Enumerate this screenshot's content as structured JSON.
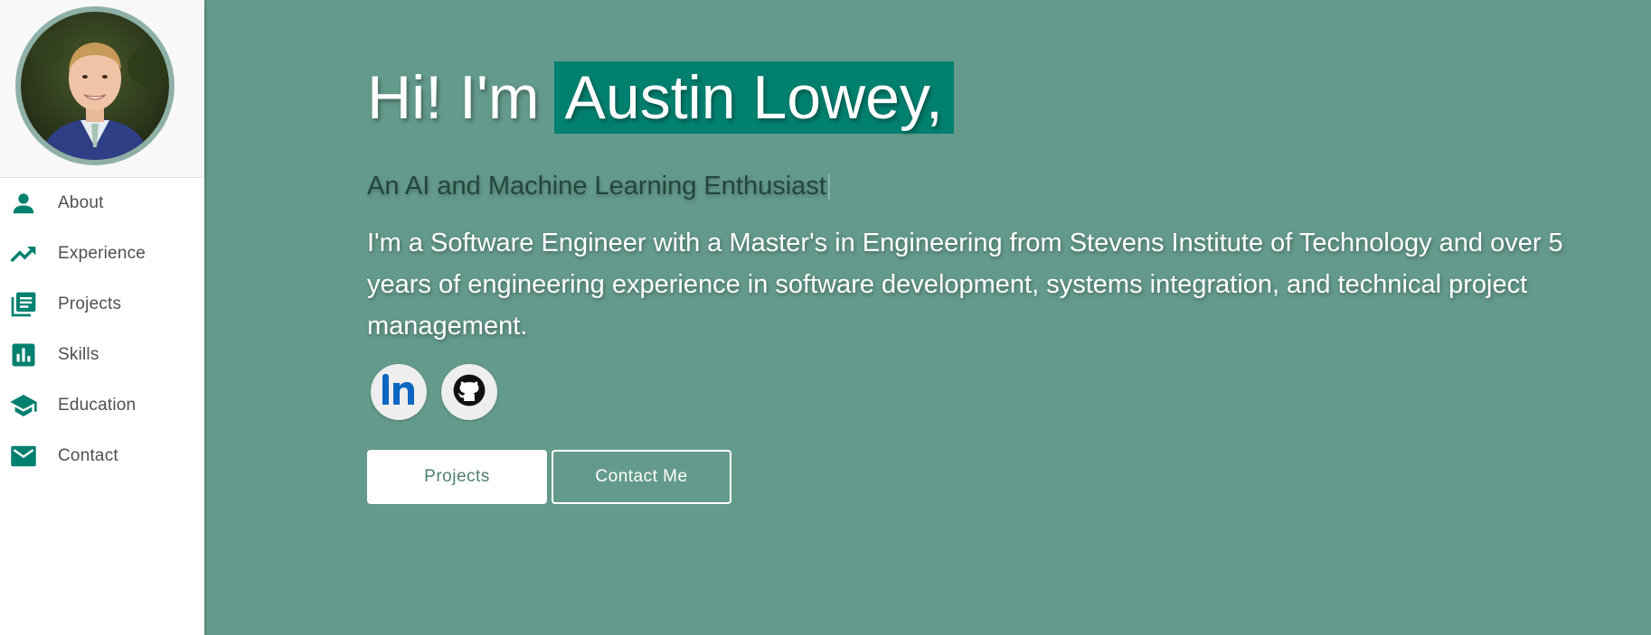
{
  "sidebar": {
    "avatar_alt": "Austin Lowey portrait",
    "items": [
      {
        "label": "About",
        "icon": "person-icon"
      },
      {
        "label": "Experience",
        "icon": "trending-up-icon"
      },
      {
        "label": "Projects",
        "icon": "library-books-icon"
      },
      {
        "label": "Skills",
        "icon": "bar-chart-icon"
      },
      {
        "label": "Education",
        "icon": "graduation-cap-icon"
      },
      {
        "label": "Contact",
        "icon": "mail-icon"
      }
    ]
  },
  "hero": {
    "greeting": "Hi! I'm",
    "name": "Austin Lowey,",
    "tagline": "An AI and Machine Learning Enthusiast",
    "bio": "I'm a Software Engineer with a Master's in Engineering from Stevens Institute of Technology and over 5 years of engineering experience in software development, systems integration, and technical project management."
  },
  "social": {
    "linkedin_icon": "linkedin-icon",
    "github_icon": "github-icon"
  },
  "buttons": {
    "projects_label": "Projects",
    "contact_label": "Contact Me"
  },
  "colors": {
    "accent": "#00806f",
    "background": "#649a8c",
    "icon": "#00806f",
    "linkedin": "#0a66c2"
  }
}
